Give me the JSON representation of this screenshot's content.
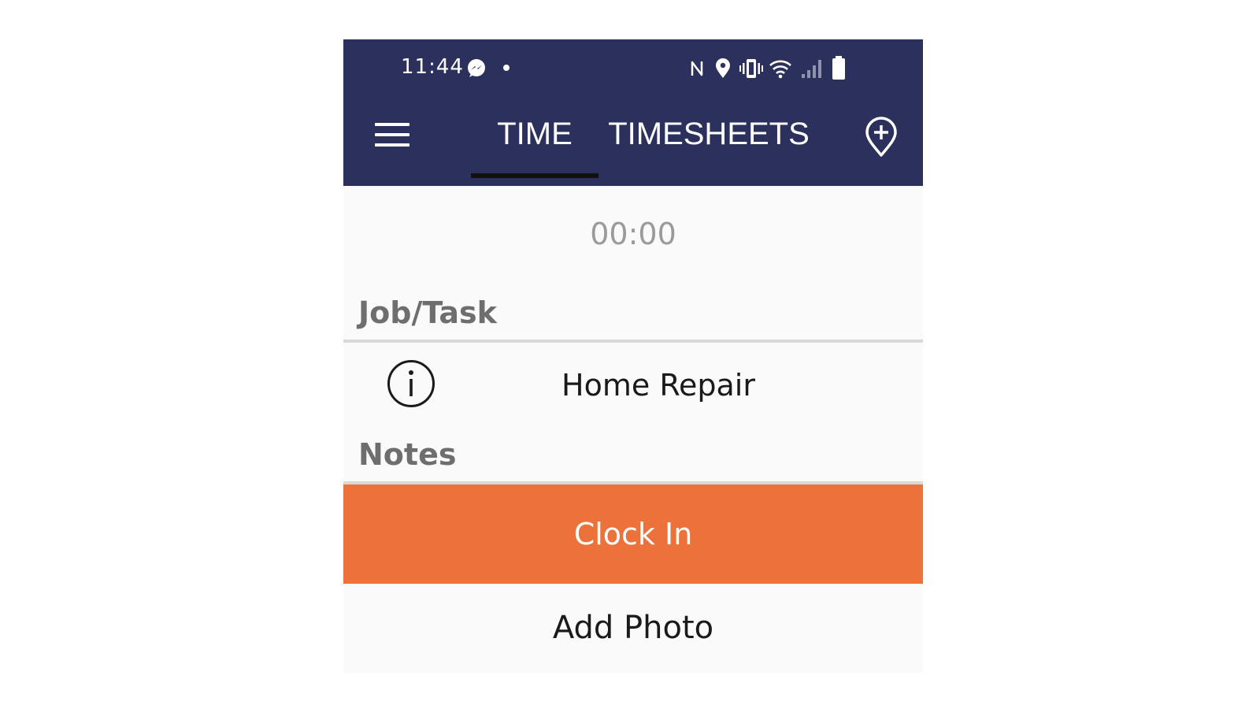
{
  "status_bar": {
    "time": "11:44",
    "icons": [
      "messenger-icon",
      "notification-dot-icon",
      "nfc-icon",
      "location-icon",
      "vibrate-icon",
      "wifi-icon",
      "cell-signal-icon",
      "battery-icon"
    ]
  },
  "toolbar": {
    "menu_icon": "hamburger-menu-icon",
    "tabs": [
      {
        "label": "TIME",
        "active": true
      },
      {
        "label": "TIMESHEETS",
        "active": false
      }
    ],
    "action_icon": "add-location-icon"
  },
  "timer": {
    "value": "00:00"
  },
  "job_task": {
    "label": "Job/Task",
    "info_icon": "info-icon",
    "value": "Home Repair"
  },
  "notes": {
    "label": "Notes"
  },
  "actions": {
    "clock_in_label": "Clock In",
    "add_photo_label": "Add Photo"
  },
  "colors": {
    "appbar": "#2c305c",
    "accent": "#ec713a",
    "background": "#fafafa",
    "tab_indicator": "#111111"
  }
}
